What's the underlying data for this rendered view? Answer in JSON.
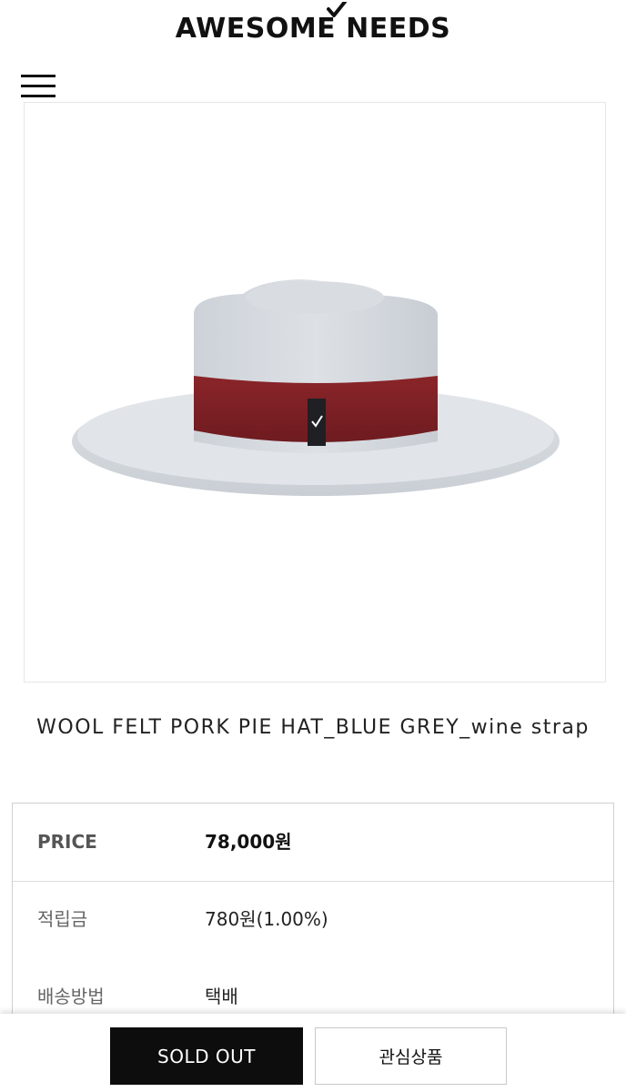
{
  "header": {
    "logo_text": "AWESOME NEEDS",
    "menu_icon": "hamburger-menu-icon"
  },
  "product": {
    "image": "grey wool felt pork pie hat with wine red band",
    "title": "WOOL FELT PORK PIE HAT_BLUE GREY_wine strap"
  },
  "info": {
    "rows": [
      {
        "label": "PRICE",
        "value": "78,000원"
      },
      {
        "label": "적립금",
        "value": "780원(1.00%)"
      },
      {
        "label": "배송방법",
        "value": "택배"
      }
    ]
  },
  "actions": {
    "sold_out_label": "SOLD OUT",
    "wishlist_label": "관심상품"
  },
  "colors": {
    "primary_button": "#0d0d0d",
    "hat_felt": "#d3d8dd",
    "hat_band": "#7d1f24"
  }
}
